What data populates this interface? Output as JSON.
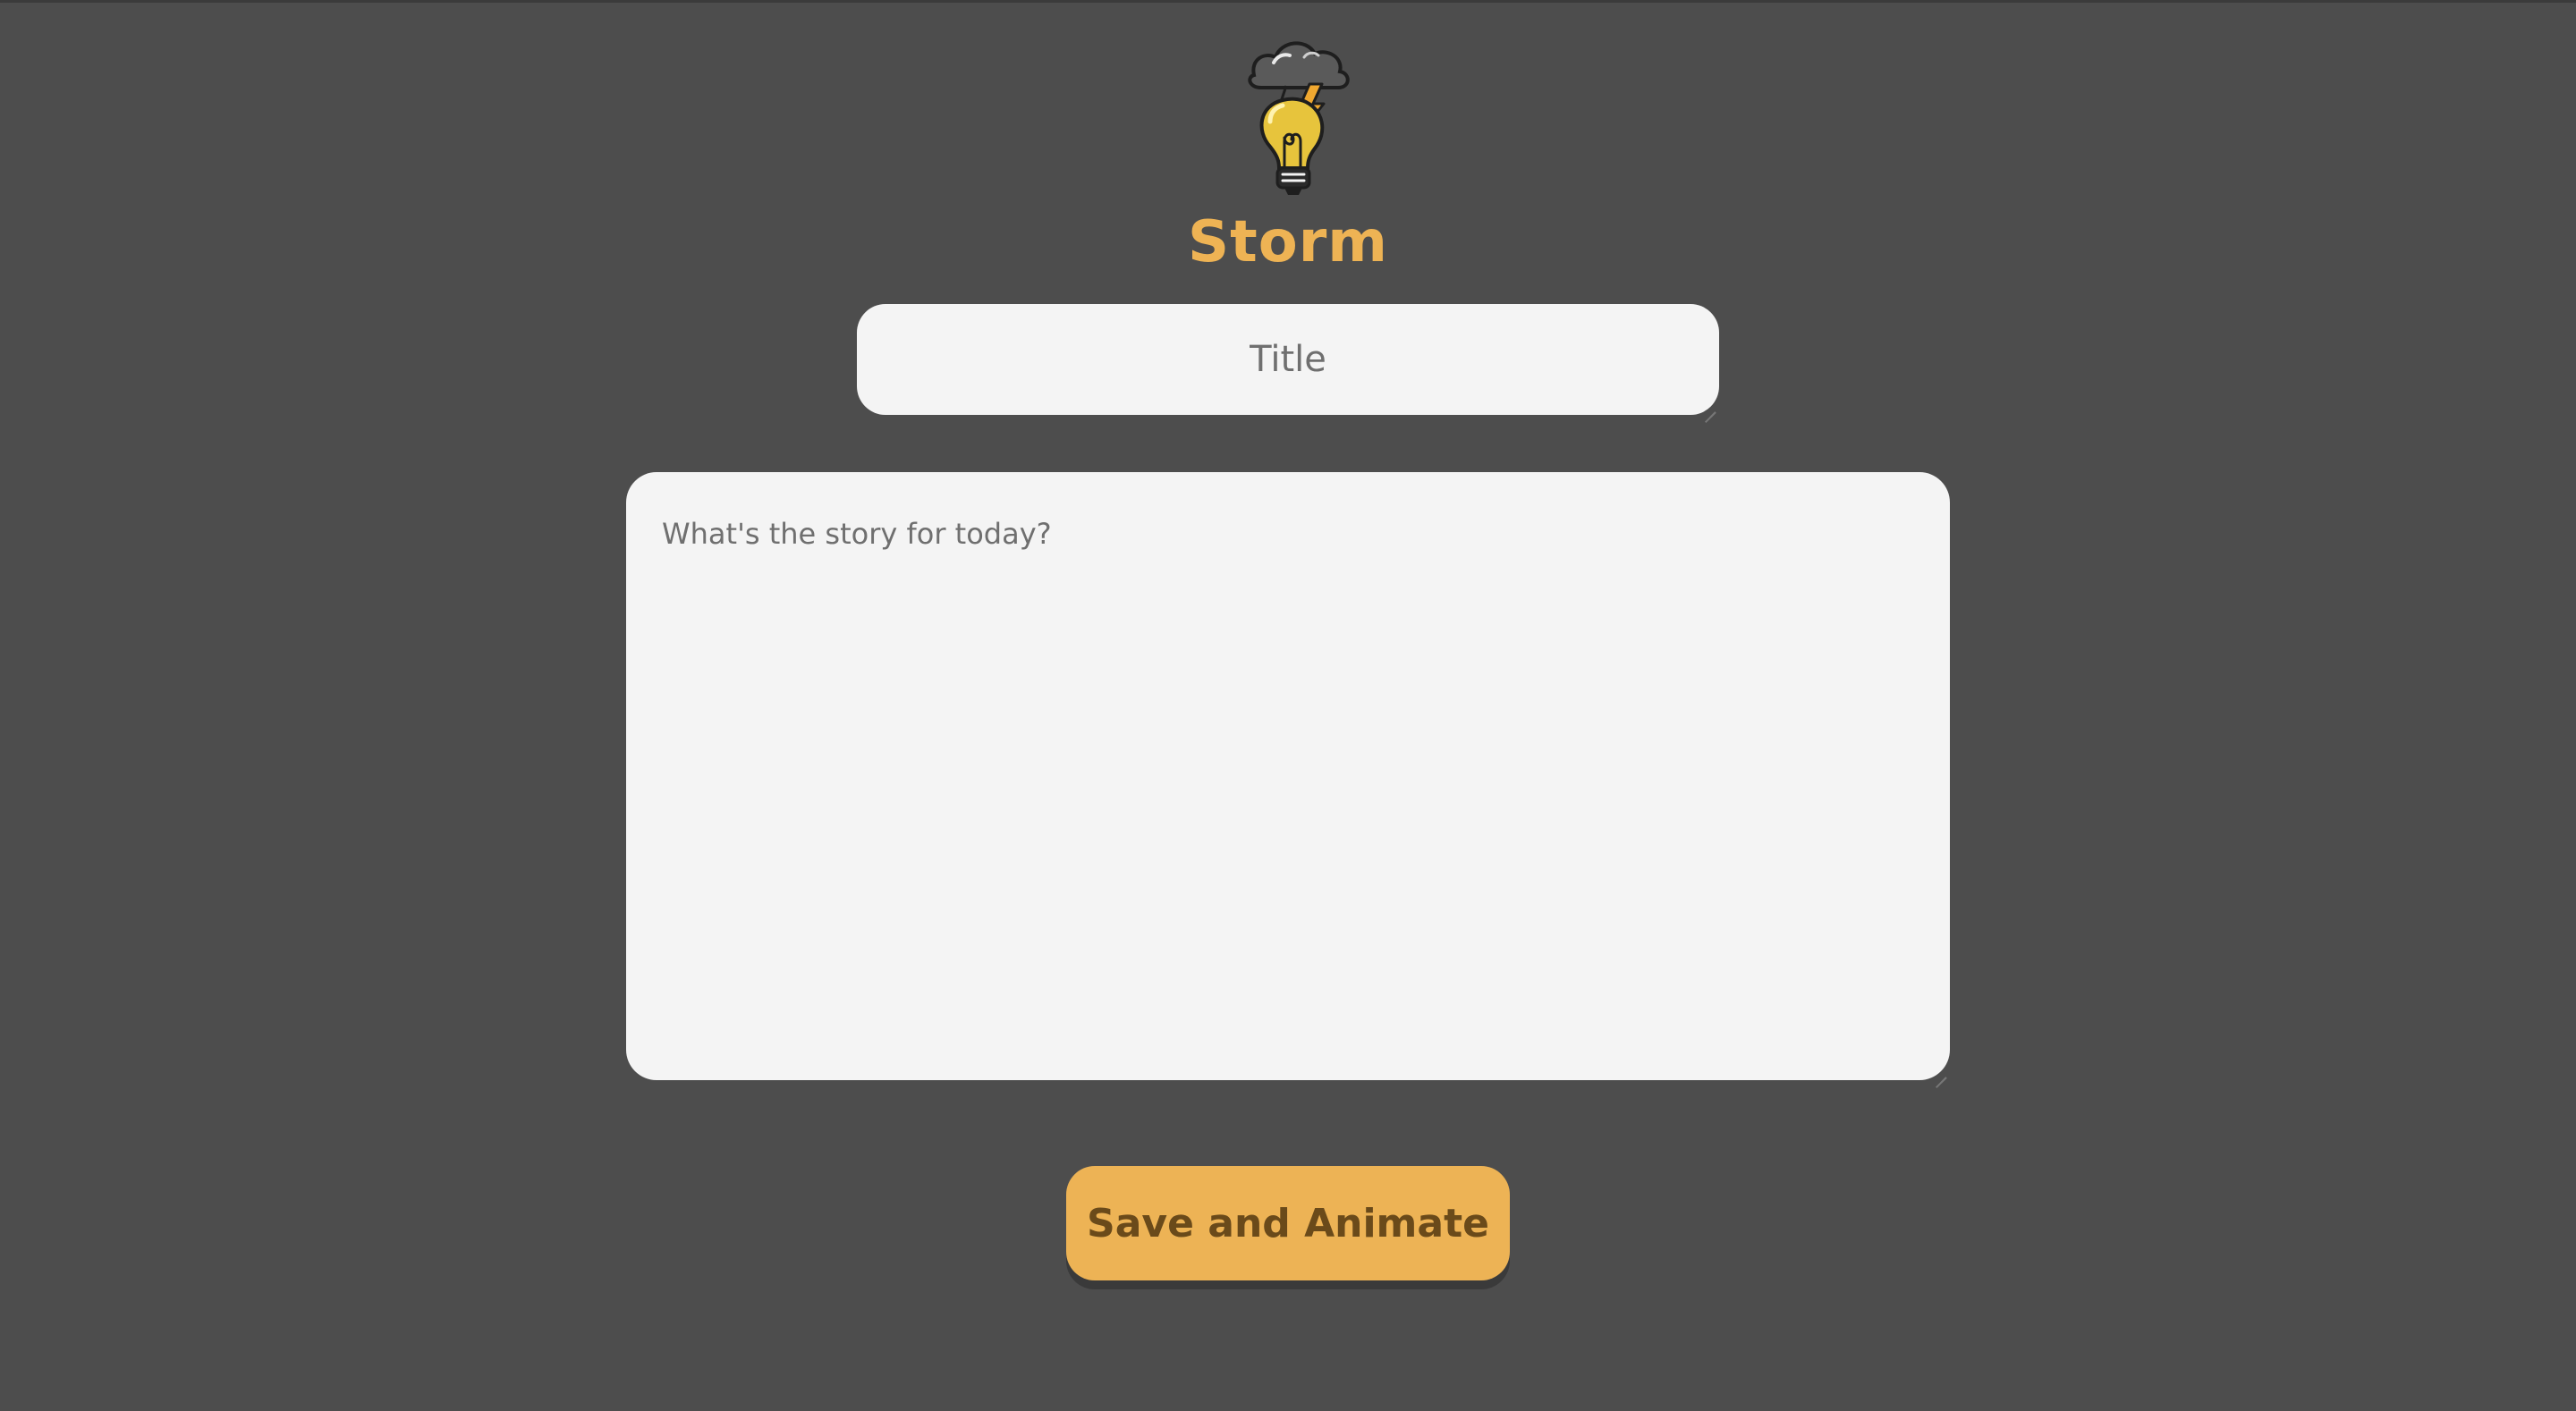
{
  "app": {
    "brand_name": "Storm",
    "logo_icon": "lightbulb-storm-cloud-icon",
    "accent_color": "#eeb354",
    "background_color": "#4d4d4d"
  },
  "form": {
    "title_placeholder": "Title",
    "title_value": "",
    "story_placeholder": "What's the story for today?",
    "story_value": "",
    "submit_label": "Save and Animate"
  }
}
